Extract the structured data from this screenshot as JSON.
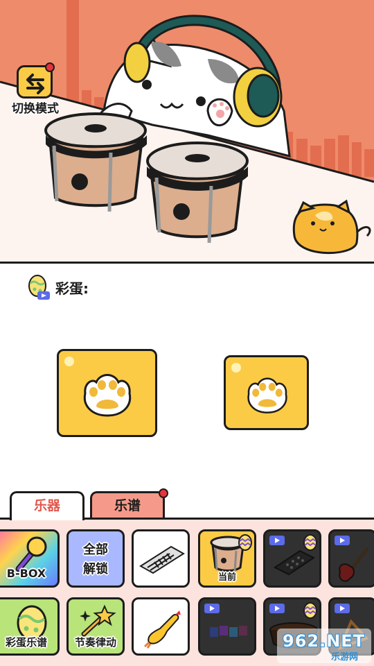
{
  "colors": {
    "scene_bg": "#ee8b6b",
    "accent_yellow": "#fccb45",
    "panel_bg": "#fde3de",
    "active_tab_text": "#e2574c",
    "inactive_tab_bg": "#f59a8a",
    "notification_dot": "#e8323c",
    "video_badge": "#5c6be8"
  },
  "scene": {
    "mode_switch": {
      "label": "切换模式",
      "icon": "swap-arrows-icon"
    }
  },
  "easter_egg": {
    "label": "彩蛋:",
    "slots": [
      {
        "icon": "paw-icon"
      },
      {
        "icon": "paw-icon"
      }
    ]
  },
  "tabs": [
    {
      "label": "乐器",
      "active": true
    },
    {
      "label": "乐谱",
      "active": false,
      "has_notification": true
    }
  ],
  "instruments_row1": [
    {
      "label": "B-BOX",
      "icon": "microphone-icon"
    },
    {
      "label": "全部\n解锁"
    },
    {
      "label": "",
      "icon": "keyboard-icon"
    },
    {
      "label": "当前",
      "icon": "bongo-icon",
      "selected": true,
      "egg_badge": true
    },
    {
      "label": "",
      "icon": "launchpad-icon",
      "video_locked": true,
      "egg_badge": true
    },
    {
      "label": "",
      "icon": "guitar-icon",
      "video_locked": true
    }
  ],
  "instruments_row2": [
    {
      "label": "彩蛋乐谱",
      "icon": "egg-icon"
    },
    {
      "label": "节奏律动",
      "icon": "magic-wand-icon"
    },
    {
      "label": "",
      "icon": "rubber-chicken-icon"
    },
    {
      "label": "",
      "icon": "cups-icon",
      "video_locked": true
    },
    {
      "label": "",
      "icon": "drum-icon",
      "video_locked": true,
      "egg_badge": true
    },
    {
      "label": "",
      "icon": "harp-icon",
      "video_locked": true
    }
  ],
  "unlock_all": {
    "line1": "全部",
    "line2": "解锁"
  },
  "watermark": {
    "text": "962.NET",
    "sub": "乐游网"
  }
}
